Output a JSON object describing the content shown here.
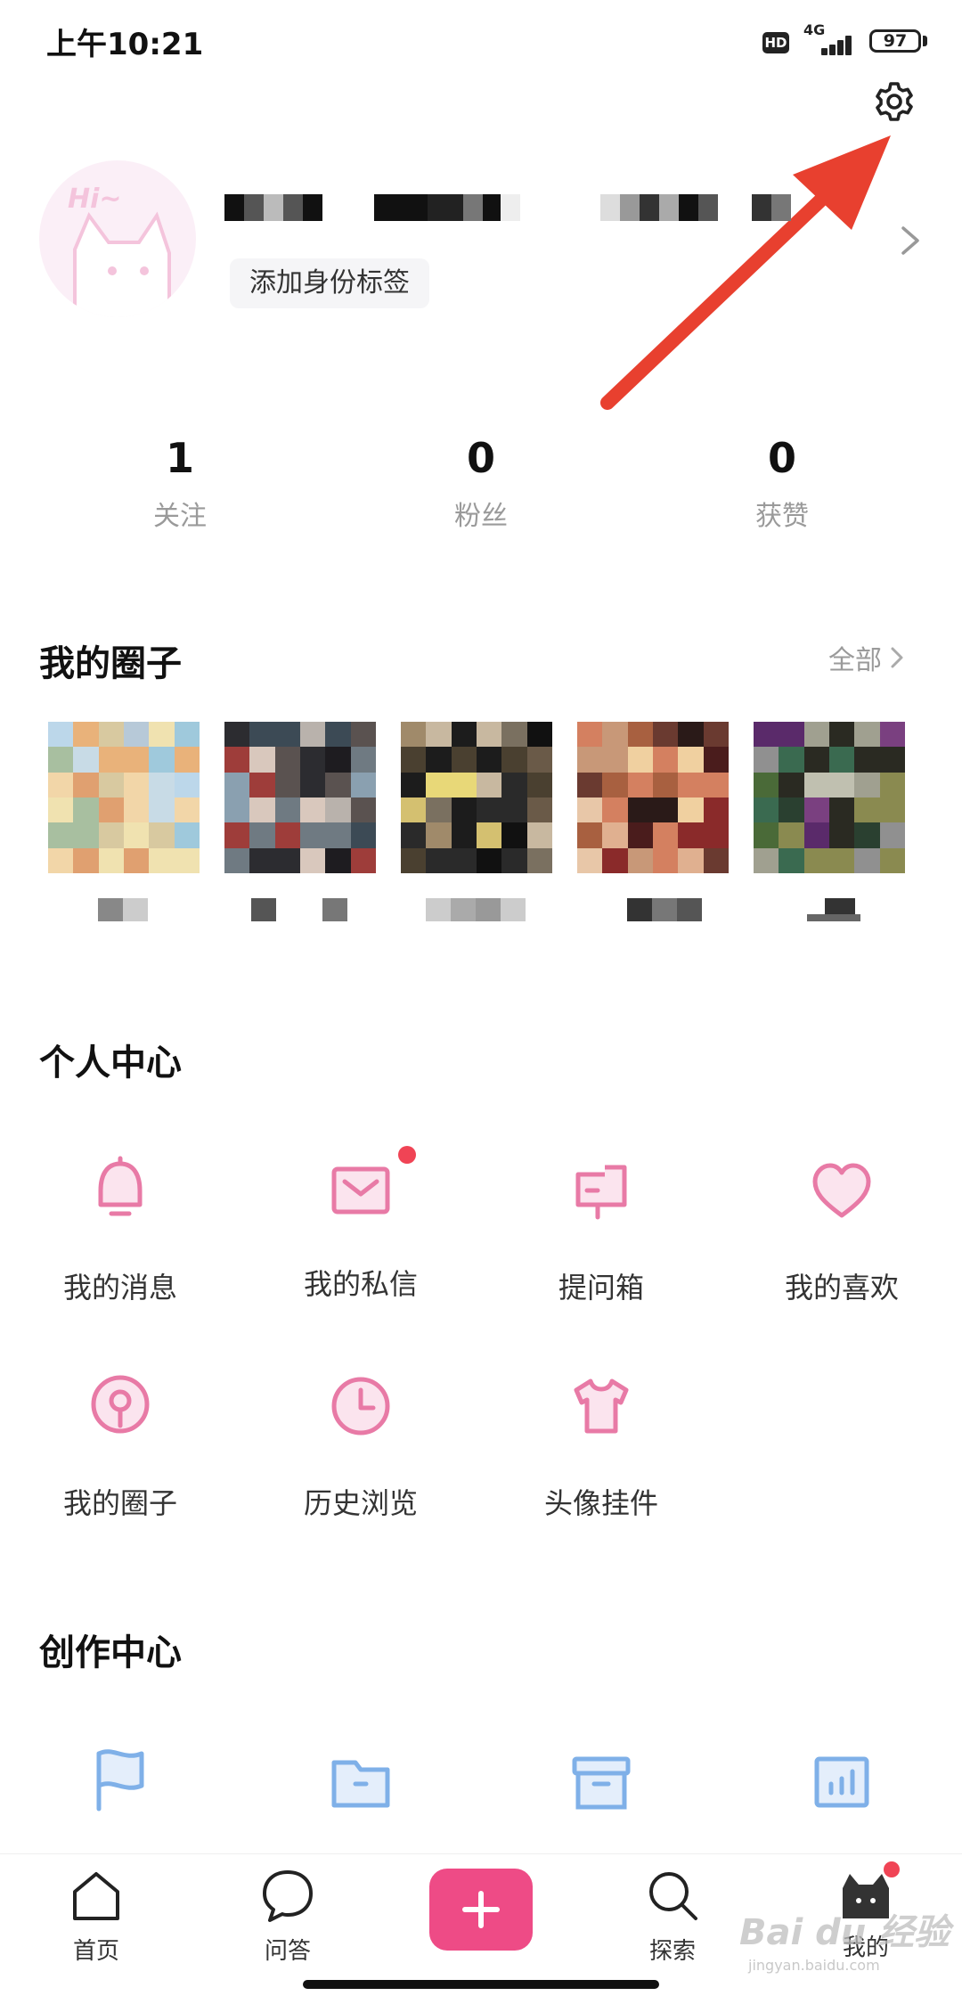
{
  "status_bar": {
    "time": "上午10:21",
    "hd": "HD",
    "network": "4G",
    "battery": "97"
  },
  "profile": {
    "tag_label": "添加身份标签"
  },
  "stats": [
    {
      "value": "1",
      "label": "关注"
    },
    {
      "value": "0",
      "label": "粉丝"
    },
    {
      "value": "0",
      "label": "获赞"
    }
  ],
  "my_circles": {
    "title": "我的圈子",
    "see_all": "全部"
  },
  "personal_center": {
    "title": "个人中心",
    "items": [
      {
        "label": "我的消息",
        "icon": "bell-icon"
      },
      {
        "label": "我的私信",
        "icon": "mail-icon",
        "badge": true
      },
      {
        "label": "提问箱",
        "icon": "mailbox-icon"
      },
      {
        "label": "我的喜欢",
        "icon": "heart-icon"
      },
      {
        "label": "我的圈子",
        "icon": "location-pin-icon"
      },
      {
        "label": "历史浏览",
        "icon": "clock-icon"
      },
      {
        "label": "头像挂件",
        "icon": "tshirt-icon"
      }
    ]
  },
  "creation_center": {
    "title": "创作中心"
  },
  "bottom_nav": [
    {
      "label": "首页",
      "icon": "home-icon"
    },
    {
      "label": "问答",
      "icon": "chat-bubble-icon"
    },
    {
      "label": "",
      "icon": "plus-icon"
    },
    {
      "label": "探索",
      "icon": "search-icon"
    },
    {
      "label": "我的",
      "icon": "cat-avatar-icon"
    }
  ],
  "watermark": {
    "main": "Bai du 经验",
    "sub": "jingyan.baidu.com"
  },
  "colors": {
    "accent_pink": "#ee4b86",
    "icon_pink": "#e87aa6",
    "icon_blue": "#7fb0e8",
    "badge_red": "#f04455"
  }
}
